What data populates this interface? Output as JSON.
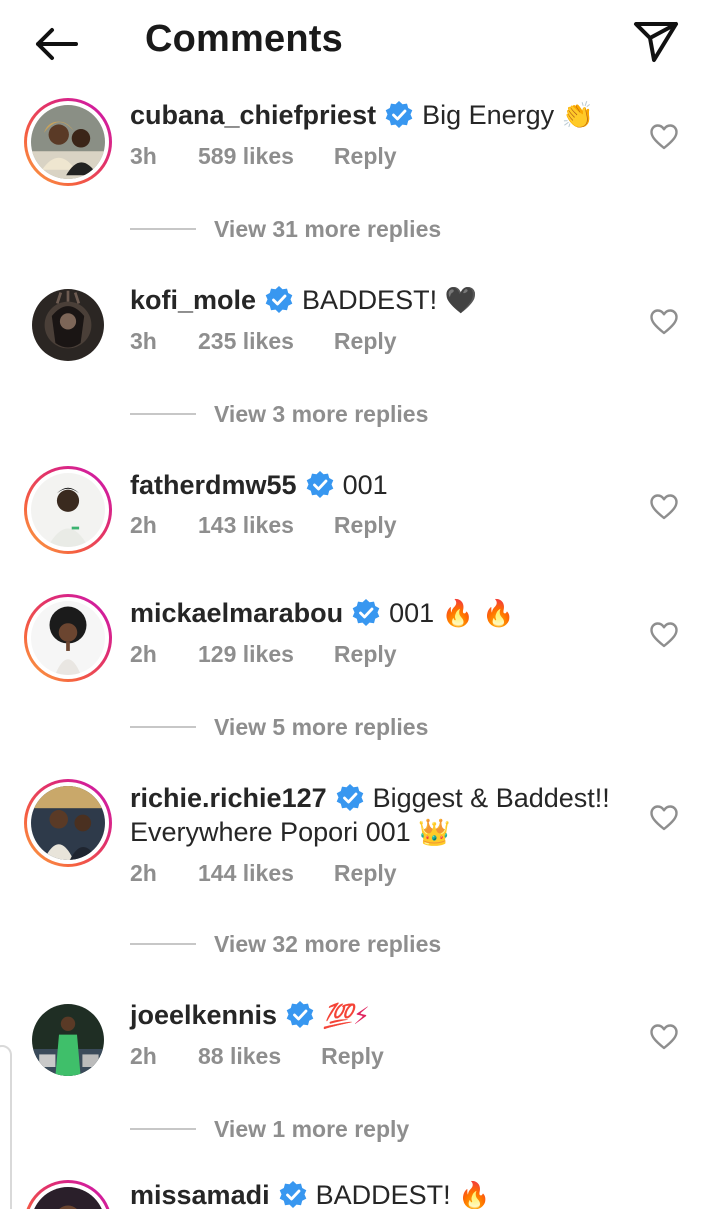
{
  "header": {
    "title": "Comments",
    "back_icon": "arrow-left-icon",
    "share_icon": "paper-plane-icon"
  },
  "colors": {
    "verified": "#3897f0",
    "meta": "#8e8e8e",
    "text": "#262626",
    "ring_start": "#c913b9",
    "ring_end": "#fcaf45"
  },
  "comments": [
    {
      "username": "cubana_chiefpriest",
      "verified": true,
      "text": "Big Energy",
      "emoji": "👏",
      "time": "3h",
      "likes": "589 likes",
      "reply": "Reply",
      "view_replies": "View 31 more replies"
    },
    {
      "username": "kofi_mole",
      "verified": true,
      "text": "BADDEST!",
      "emoji": "🖤",
      "time": "3h",
      "likes": "235 likes",
      "reply": "Reply",
      "view_replies": "View 3 more replies"
    },
    {
      "username": "fatherdmw55",
      "verified": true,
      "text": "001",
      "emoji": "",
      "time": "2h",
      "likes": "143 likes",
      "reply": "Reply"
    },
    {
      "username": "mickaelmarabou",
      "verified": true,
      "text": "001",
      "emoji": "🔥 🔥",
      "time": "2h",
      "likes": "129 likes",
      "reply": "Reply",
      "view_replies": "View 5 more replies"
    },
    {
      "username": "richie.richie127",
      "verified": true,
      "text": "Biggest & Baddest!!",
      "text2": "Everywhere Popori 001",
      "emoji": "👑",
      "time": "2h",
      "likes": "144 likes",
      "reply": "Reply",
      "view_replies": "View 32 more replies"
    },
    {
      "username": "joeelkennis",
      "verified": true,
      "text": "",
      "emoji": "💯⚡",
      "time": "2h",
      "likes": "88 likes",
      "reply": "Reply",
      "view_replies": "View 1 more reply"
    },
    {
      "username": "missamadi",
      "verified": true,
      "text": "BADDEST!",
      "emoji": "🔥"
    }
  ]
}
